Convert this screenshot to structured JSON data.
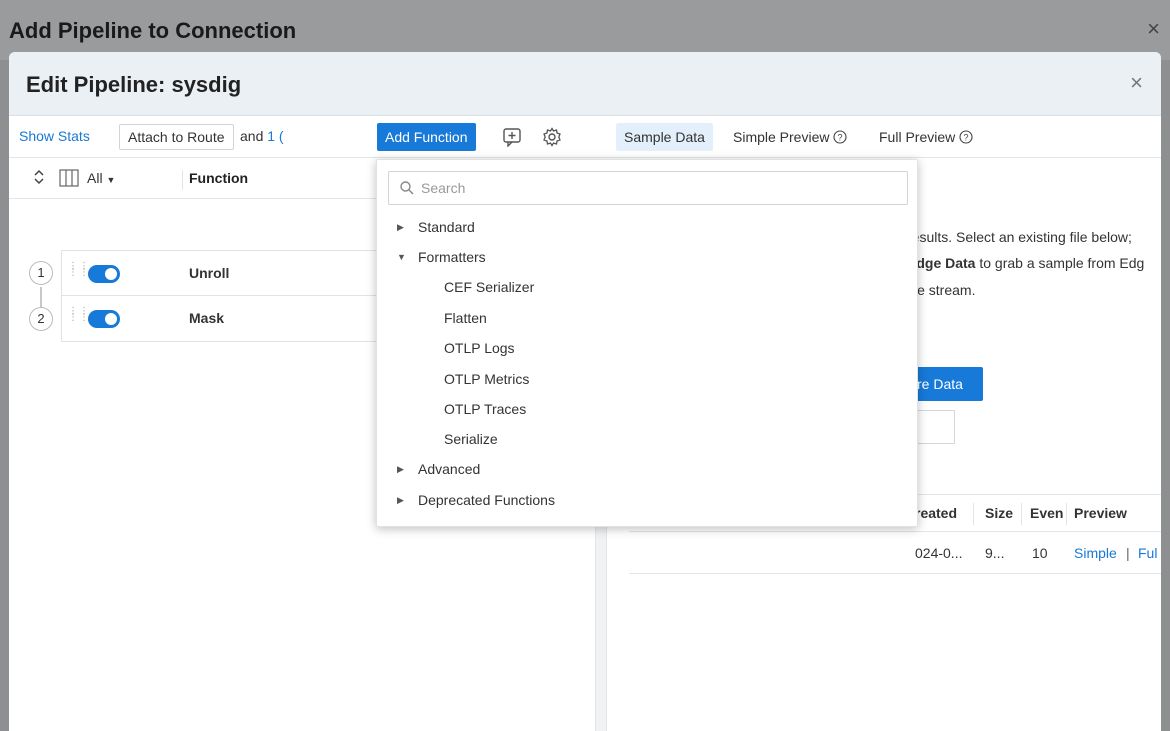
{
  "outer": {
    "title": "Add Pipeline to Connection",
    "close": "×"
  },
  "modal": {
    "title": "Edit Pipeline: sysdig",
    "close": "×"
  },
  "toolbar": {
    "show_stats": "Show Stats",
    "attach": "Attach to Route",
    "and_text": "and",
    "and_count": "1 (",
    "add_function": "Add Function",
    "icons": [
      "add-comment-icon",
      "gear-icon"
    ]
  },
  "tabs": [
    {
      "label": "Sample Data",
      "active": true
    },
    {
      "label": "Simple Preview",
      "icon": "help-circle-icon"
    },
    {
      "label": "Full Preview",
      "icon": "help-circle-icon"
    }
  ],
  "left": {
    "all_label": "All",
    "function_header": "Function",
    "rows": [
      {
        "num": "1",
        "label": "Unroll",
        "enabled": true
      },
      {
        "num": "2",
        "label": "Mask",
        "enabled": true
      }
    ]
  },
  "right": {
    "info_line1": "results. Select an existing file below;",
    "info_line2_bold": "Edge Data",
    "info_line2": "to grab a sample from Edg",
    "info_line3": "ive stream.",
    "capture_label": "re Data",
    "columns": [
      "reated",
      "Size",
      "Even",
      "Preview"
    ],
    "row": {
      "created": "024-0...",
      "size": "9...",
      "events": "10",
      "simple": "Simple",
      "sep": "|",
      "full": "Ful"
    }
  },
  "dropdown": {
    "search_placeholder": "Search",
    "items": [
      {
        "label": "Standard",
        "expanded": false
      },
      {
        "label": "Formatters",
        "expanded": true,
        "children": [
          "CEF Serializer",
          "Flatten",
          "OTLP Logs",
          "OTLP Metrics",
          "OTLP Traces",
          "Serialize"
        ]
      },
      {
        "label": "Advanced",
        "expanded": false
      },
      {
        "label": "Deprecated Functions",
        "expanded": false
      }
    ]
  }
}
